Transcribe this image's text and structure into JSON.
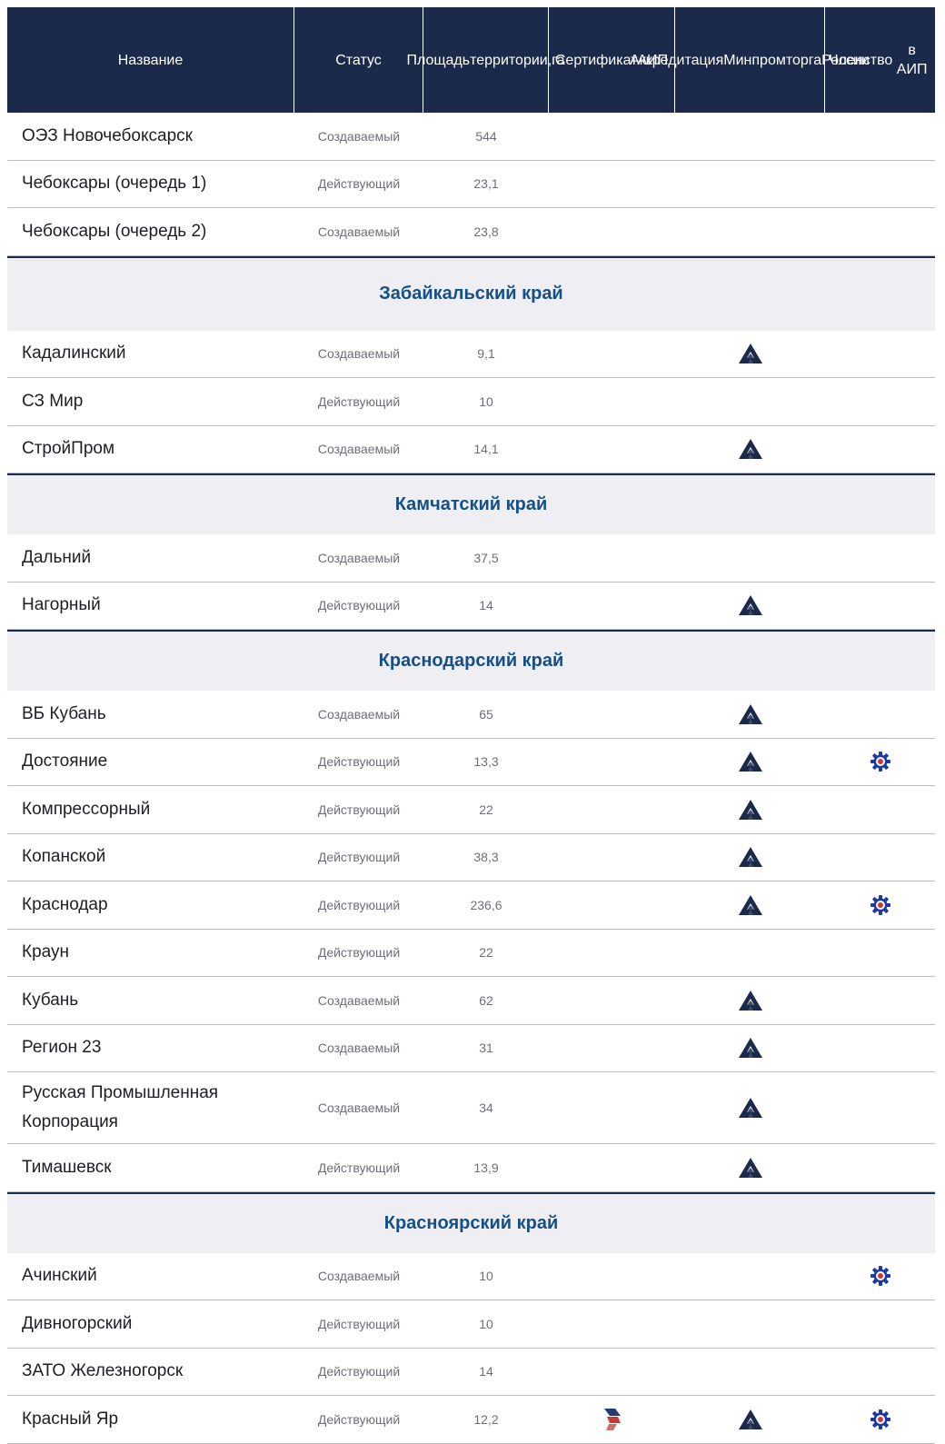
{
  "headers": [
    "Название",
    "Статус",
    "Площадь территории, га",
    "Сертификат АИП",
    "Аккредитация Минпромторга России",
    "Членство в АИП"
  ],
  "header_lines": [
    [
      "Название"
    ],
    [
      "Статус"
    ],
    [
      "Площадь",
      "территории,",
      "га"
    ],
    [
      "Сертификат",
      "АИП"
    ],
    [
      "Аккредитация",
      "Минпромторга",
      "России"
    ],
    [
      "Членство",
      "в АИП"
    ]
  ],
  "colors": {
    "header_bg": "#1b2a4a",
    "region_text": "#154f86",
    "region_bg": "#efeff3",
    "accreditation_icon": "#1b2a4a",
    "membership_icon": "#1a3aa8",
    "certificate_icon": "#c83a3a"
  },
  "icons": {
    "certificate": "aip-certificate-icon",
    "accreditation": "minpromtorg-accreditation-icon",
    "membership": "aip-membership-gear-icon"
  },
  "rows": [
    {
      "type": "park",
      "name": "ОЭЗ Новочебоксарск",
      "status": "Создаваемый",
      "area": "544",
      "cert": false,
      "accr": false,
      "member": false
    },
    {
      "type": "park",
      "name": "Чебоксары (очередь 1)",
      "status": "Действующий",
      "area": "23,1",
      "cert": false,
      "accr": false,
      "member": false
    },
    {
      "type": "park",
      "name": "Чебоксары (очередь 2)",
      "status": "Создаваемый",
      "area": "23,8",
      "cert": false,
      "accr": false,
      "member": false
    },
    {
      "type": "region",
      "name": "Забайкальский край"
    },
    {
      "type": "park",
      "name": "Кадалинский",
      "status": "Создаваемый",
      "area": "9,1",
      "cert": false,
      "accr": true,
      "member": false
    },
    {
      "type": "park",
      "name": "СЗ Мир",
      "status": "Действующий",
      "area": "10",
      "cert": false,
      "accr": false,
      "member": false
    },
    {
      "type": "park",
      "name": "СтройПром",
      "status": "Создаваемый",
      "area": "14,1",
      "cert": false,
      "accr": true,
      "member": false
    },
    {
      "type": "region",
      "name": "Камчатский край"
    },
    {
      "type": "park",
      "name": "Дальний",
      "status": "Создаваемый",
      "area": "37,5",
      "cert": false,
      "accr": false,
      "member": false
    },
    {
      "type": "park",
      "name": "Нагорный",
      "status": "Действующий",
      "area": "14",
      "cert": false,
      "accr": true,
      "member": false
    },
    {
      "type": "region",
      "name": "Краснодарский край"
    },
    {
      "type": "park",
      "name": "ВБ Кубань",
      "status": "Создаваемый",
      "area": "65",
      "cert": false,
      "accr": true,
      "member": false
    },
    {
      "type": "park",
      "name": "Достояние",
      "status": "Действующий",
      "area": "13,3",
      "cert": false,
      "accr": true,
      "member": true
    },
    {
      "type": "park",
      "name": "Компрессорный",
      "status": "Действующий",
      "area": "22",
      "cert": false,
      "accr": true,
      "member": false
    },
    {
      "type": "park",
      "name": "Копанской",
      "status": "Действующий",
      "area": "38,3",
      "cert": false,
      "accr": true,
      "member": false
    },
    {
      "type": "park",
      "name": "Краснодар",
      "status": "Действующий",
      "area": "236,6",
      "cert": false,
      "accr": true,
      "member": true
    },
    {
      "type": "park",
      "name": "Краун",
      "status": "Действующий",
      "area": "22",
      "cert": false,
      "accr": false,
      "member": false
    },
    {
      "type": "park",
      "name": "Кубань",
      "status": "Создаваемый",
      "area": "62",
      "cert": false,
      "accr": true,
      "member": false
    },
    {
      "type": "park",
      "name": "Регион 23",
      "status": "Создаваемый",
      "area": "31",
      "cert": false,
      "accr": true,
      "member": false
    },
    {
      "type": "park",
      "name": "Русская Промышленная Корпорация",
      "status": "Создаваемый",
      "area": "34",
      "cert": false,
      "accr": true,
      "member": false
    },
    {
      "type": "park",
      "name": "Тимашевск",
      "status": "Действующий",
      "area": "13,9",
      "cert": false,
      "accr": true,
      "member": false
    },
    {
      "type": "region",
      "name": "Красноярский край"
    },
    {
      "type": "park",
      "name": "Ачинский",
      "status": "Создаваемый",
      "area": "10",
      "cert": false,
      "accr": false,
      "member": true
    },
    {
      "type": "park",
      "name": "Дивногорский",
      "status": "Действующий",
      "area": "10",
      "cert": false,
      "accr": false,
      "member": false
    },
    {
      "type": "park",
      "name": "ЗАТО Железногорск",
      "status": "Действующий",
      "area": "14",
      "cert": false,
      "accr": false,
      "member": false
    },
    {
      "type": "park",
      "name": "Красный Яр",
      "status": "Действующий",
      "area": "12,2",
      "cert": true,
      "accr": true,
      "member": true
    }
  ]
}
